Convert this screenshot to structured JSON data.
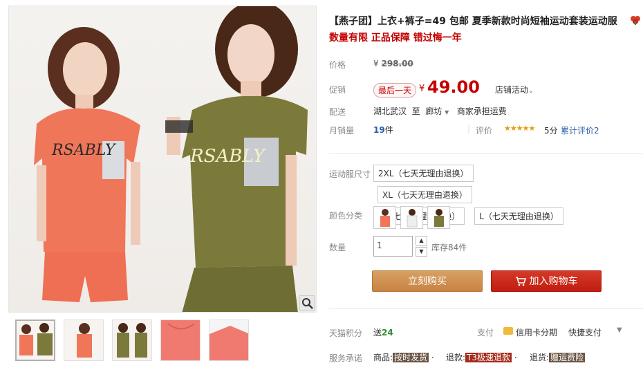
{
  "product": {
    "title": "【燕子团】上衣+裤子=49 包邮 夏季新款时尚短袖运动套装运动服",
    "subtitle": "数量有限 正品保障 错过悔一年"
  },
  "price": {
    "label": "价格",
    "original_yen": "¥",
    "original_value": "298.00",
    "promo_label": "促销",
    "promo_badge": "最后一天",
    "promo_yen": "¥",
    "promo_value": "49.00",
    "store_activity": "店铺活动"
  },
  "shipping": {
    "label": "配送",
    "from": "湖北武汉",
    "to_word": "至",
    "to": "廊坊",
    "fee": "商家承担运费"
  },
  "sales": {
    "label": "月销量",
    "count": "19",
    "unit": "件",
    "eval_label": "评价",
    "stars": "★★★★★",
    "score": "5分",
    "eval_count": "累计评价2"
  },
  "options": {
    "size_label": "运动服尺寸",
    "sizes": [
      "2XL（七天无理由退换）",
      "XL（七天无理由退换）",
      "M（七天无理由退换）",
      "L（七天无理由退换）"
    ],
    "color_label": "颜色分类",
    "colors": [
      "orange-red",
      "white",
      "olive-green"
    ],
    "qty_label": "数量",
    "qty_value": "1",
    "stock": "库存84件"
  },
  "buttons": {
    "buy": "立刻购买",
    "cart": "加入购物车"
  },
  "points": {
    "label": "天猫积分",
    "send_word": "送",
    "value": "24"
  },
  "payment": {
    "label": "支付",
    "credit": "信用卡分期",
    "fast": "快捷支付"
  },
  "service": {
    "label": "服务承诺",
    "goods_label": "商品:",
    "goods_tag": "按时发货",
    "refund_label": "退款:",
    "refund_tag": "T3极速退款",
    "return_label": "退货:",
    "return_tag": "赠运费险"
  },
  "colors": {
    "accent_red": "#c40000",
    "buy_button": "#c88342",
    "cart_button": "#c11d10",
    "link_blue": "#2a5da8"
  },
  "icons": [
    "magnifier-icon",
    "cart-icon",
    "credit-card-icon",
    "chevron-down-icon",
    "flower-icon"
  ]
}
